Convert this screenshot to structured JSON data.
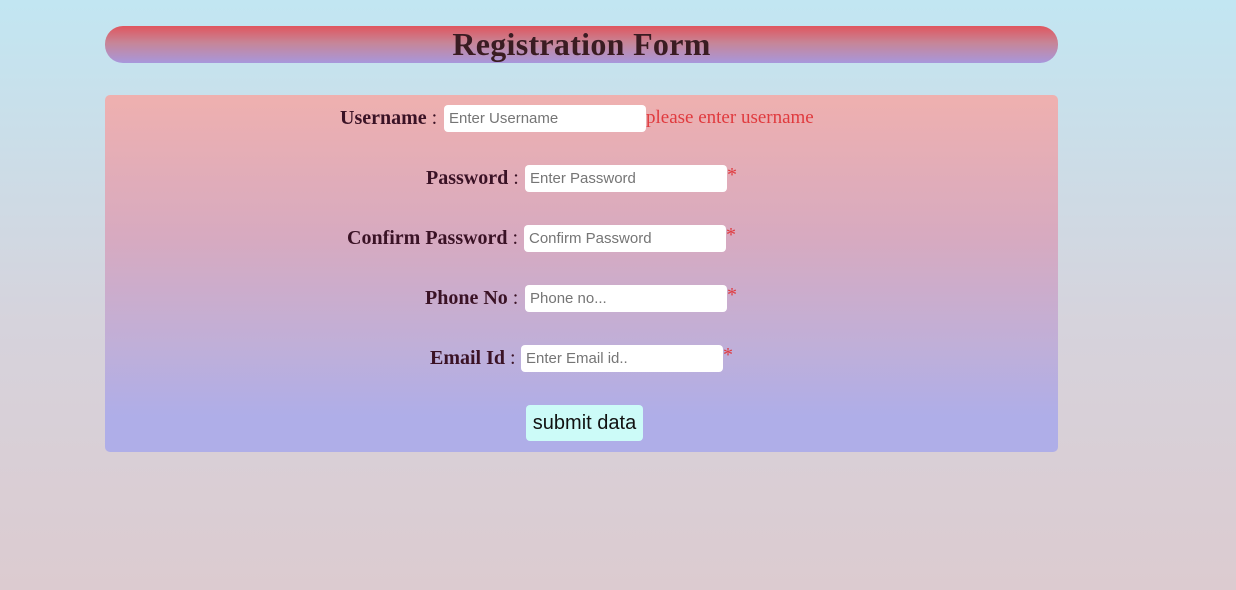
{
  "header": {
    "title": "Registration Form"
  },
  "form": {
    "username": {
      "label": "Username",
      "separator": ":",
      "placeholder": "Enter Username",
      "value": "",
      "validation": "please enter username"
    },
    "password": {
      "label": "Password",
      "separator": ":",
      "placeholder": "Enter Password",
      "value": "",
      "required_mark": "*"
    },
    "confirm_password": {
      "label": "Confirm Password",
      "separator": ":",
      "placeholder": "Confirm Password",
      "value": "",
      "required_mark": "*"
    },
    "phone": {
      "label": "Phone No",
      "separator": ":",
      "placeholder": "Phone no...",
      "value": "",
      "required_mark": "*"
    },
    "email": {
      "label": "Email Id",
      "separator": ":",
      "placeholder": "Enter Email id..",
      "value": "",
      "required_mark": "*"
    },
    "submit_label": "submit data"
  },
  "colors": {
    "error_text": "#e03a3e",
    "label_text": "#3a1225",
    "submit_bg": "#ccfbf8"
  }
}
